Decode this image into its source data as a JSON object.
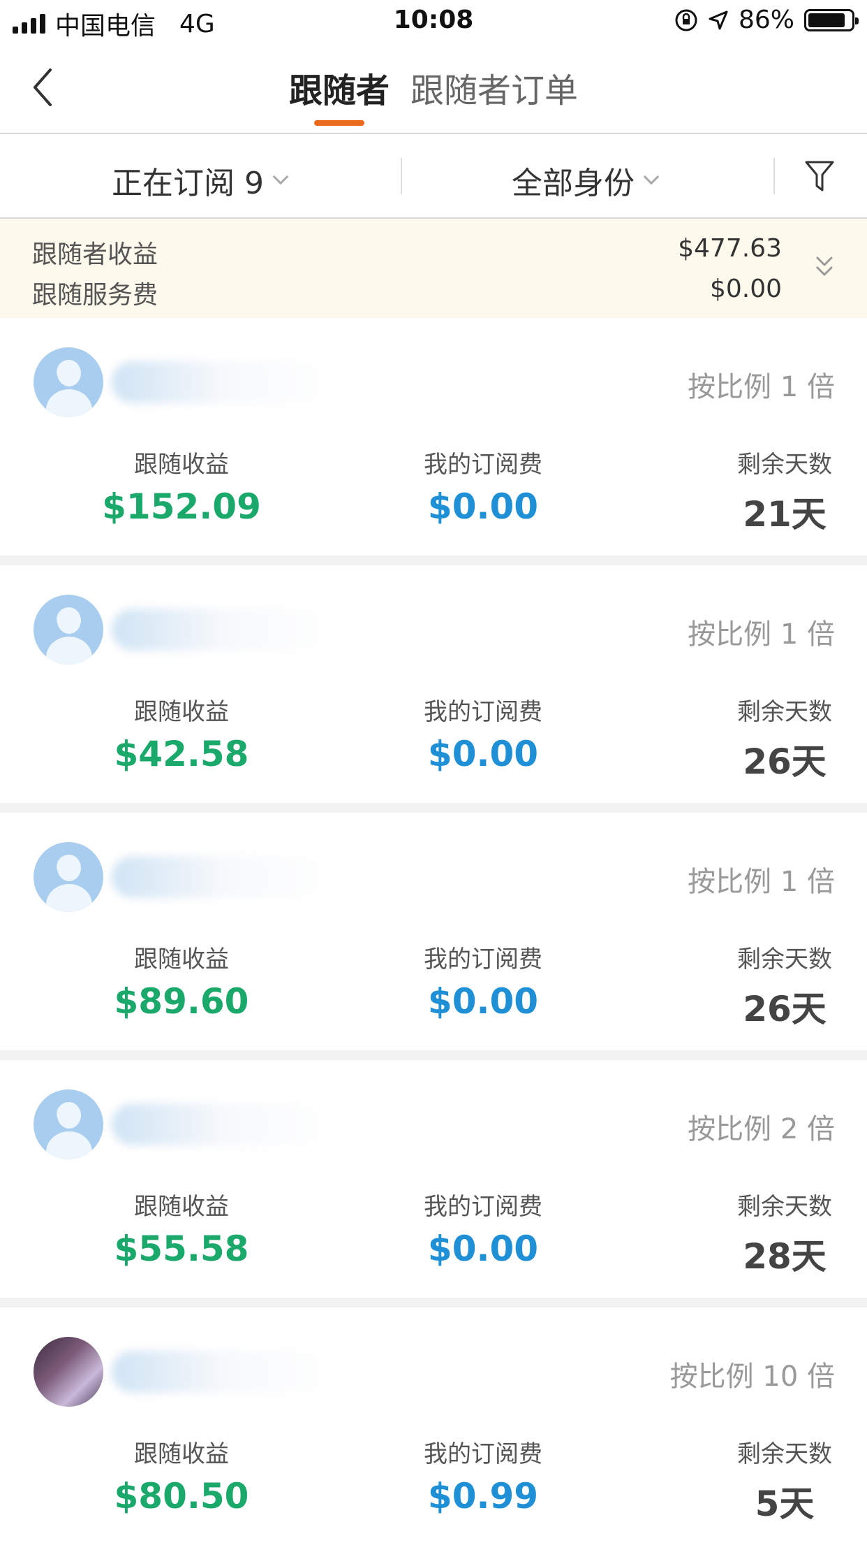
{
  "status_bar": {
    "carrier": "中国电信",
    "network": "4G",
    "time": "10:08",
    "battery": "86%",
    "battery_level": 0.86
  },
  "nav": {
    "tab_active": "跟随者",
    "tab_inactive": "跟随者订单"
  },
  "filters": {
    "status": "正在订阅 9",
    "role": "全部身份"
  },
  "summary": {
    "earnings_label": "跟随者收益",
    "earnings_value": "$477.63",
    "fee_label": "跟随服务费",
    "fee_value": "$0.00"
  },
  "cards": [
    {
      "ratio": "按比例 1 倍",
      "earnings_label": "跟随收益",
      "earnings": "$152.09",
      "fee_label": "我的订阅费",
      "fee": "$0.00",
      "days_label": "剩余天数",
      "days": "21天"
    },
    {
      "ratio": "按比例 1 倍",
      "earnings_label": "跟随收益",
      "earnings": "$42.58",
      "fee_label": "我的订阅费",
      "fee": "$0.00",
      "days_label": "剩余天数",
      "days": "26天"
    },
    {
      "ratio": "按比例 1 倍",
      "earnings_label": "跟随收益",
      "earnings": "$89.60",
      "fee_label": "我的订阅费",
      "fee": "$0.00",
      "days_label": "剩余天数",
      "days": "26天"
    },
    {
      "ratio": "按比例 2 倍",
      "earnings_label": "跟随收益",
      "earnings": "$55.58",
      "fee_label": "我的订阅费",
      "fee": "$0.00",
      "days_label": "剩余天数",
      "days": "28天"
    },
    {
      "ratio": "按比例 10 倍",
      "earnings_label": "跟随收益",
      "earnings": "$80.50",
      "fee_label": "我的订阅费",
      "fee": "$0.99",
      "days_label": "剩余天数",
      "days": "5天"
    }
  ],
  "colors": {
    "accent": "#ea6a1c",
    "earnings": "#1aa86b",
    "fee": "#1f8fd6",
    "summary_bg": "#fdf9ec"
  }
}
